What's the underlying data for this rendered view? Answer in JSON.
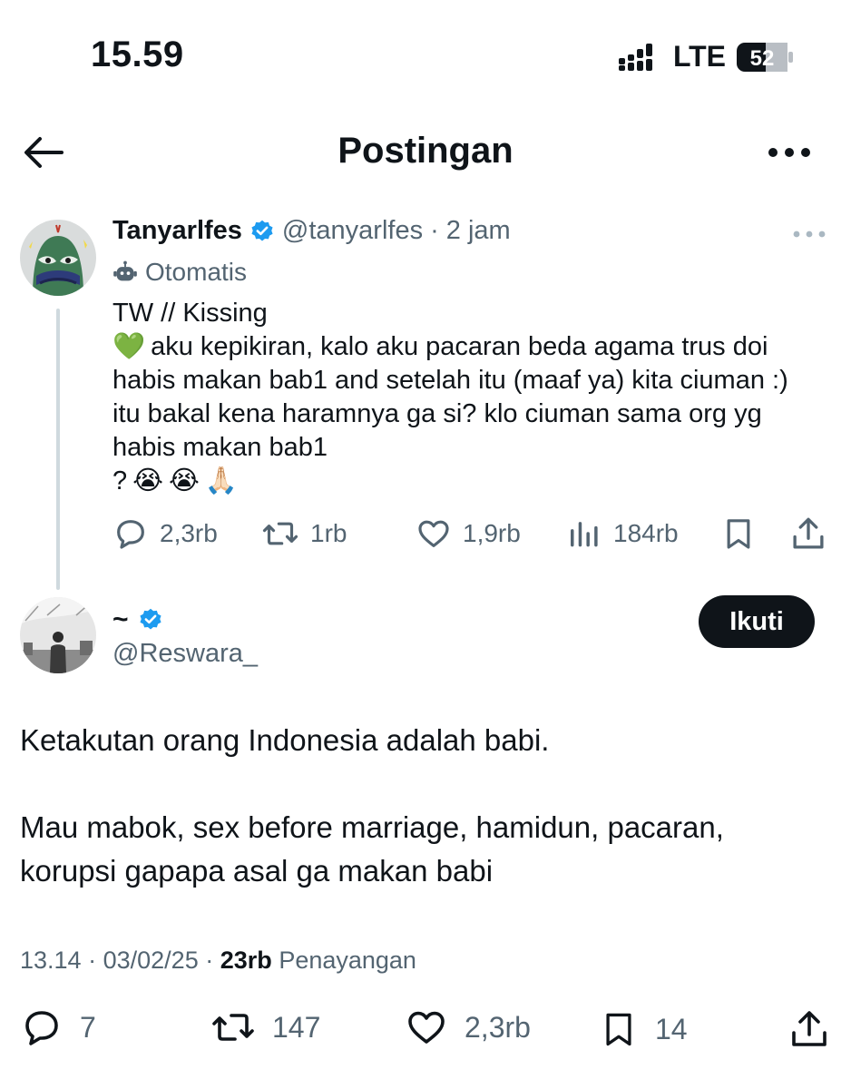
{
  "status_bar": {
    "time": "15.59",
    "network": "LTE",
    "battery": "52"
  },
  "header": {
    "title": "Postingan"
  },
  "quoted_post": {
    "display_name": "Tanyarlfes",
    "handle": "@tanyarlfes",
    "separator": "·",
    "time": "2 jam",
    "automated_label": "Otomatis",
    "text_lines": [
      "TW // Kissing",
      "aku kepikiran, kalo aku pacaran beda agama trus doi",
      "habis makan bab1 and setelah itu (maaf ya) kita ciuman :)",
      "itu bakal kena haramnya ga si? klo ciuman sama org yg",
      "habis makan bab1",
      "?"
    ],
    "emojis": {
      "heart": "💚",
      "cry": "😭",
      "pray": "🙏🏻"
    },
    "stats": {
      "replies": "2,3rb",
      "reposts": "1rb",
      "likes": "1,9rb",
      "views": "184rb"
    }
  },
  "reply": {
    "display_name": "~",
    "handle": "@Reswara_",
    "follow_label": "Ikuti",
    "text_lines": [
      "Ketakutan orang Indonesia adalah babi.",
      "Mau mabok, sex before marriage, hamidun, pacaran,",
      "korupsi gapapa asal ga makan babi"
    ],
    "meta": {
      "time": "13.14",
      "separator": "·",
      "date": "03/02/25",
      "views_count": "23rb",
      "views_label": "Penayangan"
    },
    "stats": {
      "replies": "7",
      "reposts": "147",
      "likes": "2,3rb",
      "bookmarks": "14"
    }
  },
  "colors": {
    "text": "#0f1419",
    "secondary": "#536471",
    "verified": "#1d9bf0",
    "divider": "#cfd9de"
  }
}
